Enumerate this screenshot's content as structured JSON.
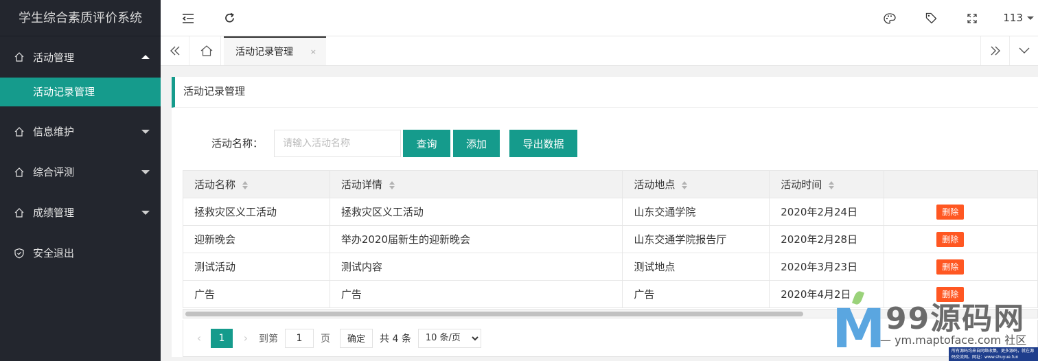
{
  "app": {
    "title": "学生综合素质评价系统"
  },
  "sidebar": {
    "items": [
      {
        "label": "活动管理",
        "icon": "home-icon",
        "expanded": true
      },
      {
        "label": "活动记录管理",
        "active": true
      },
      {
        "label": "信息维护",
        "icon": "home-icon"
      },
      {
        "label": "综合评测",
        "icon": "home-icon"
      },
      {
        "label": "成绩管理",
        "icon": "home-icon"
      },
      {
        "label": "安全退出",
        "icon": "shield-icon"
      }
    ]
  },
  "header": {
    "left_icons": [
      "menu-fold-icon",
      "refresh-icon"
    ],
    "right_icons": [
      "palette-icon",
      "tag-icon",
      "fullscreen-icon"
    ],
    "user": "113"
  },
  "tabs": {
    "active_label": "活动记录管理",
    "close_symbol": "×"
  },
  "panel": {
    "title": "活动记录管理",
    "search": {
      "label": "活动名称：",
      "placeholder": "请输入活动名称",
      "query_label": "查询",
      "add_label": "添加",
      "export_label": "导出数据"
    },
    "table": {
      "columns": [
        "活动名称",
        "活动详情",
        "活动地点",
        "活动时间",
        ""
      ],
      "rows": [
        {
          "name": "拯救灾区义工活动",
          "detail": "拯救灾区义工活动",
          "place": "山东交通学院",
          "time": "2020年2月24日",
          "action": "删除"
        },
        {
          "name": "迎新晚会",
          "detail": "举办2020届新生的迎新晚会",
          "place": "山东交通学院报告厅",
          "time": "2020年2月28日",
          "action": "删除"
        },
        {
          "name": "测试活动",
          "detail": "测试内容",
          "place": "测试地点",
          "time": "2020年3月23日",
          "action": "删除"
        },
        {
          "name": "广告",
          "detail": "广告",
          "place": "广告",
          "time": "2020年4月2日",
          "action": "删除"
        }
      ]
    },
    "pager": {
      "prev": "‹",
      "current": "1",
      "next": "›",
      "goto_label": "到第",
      "goto_value": "1",
      "page_unit": "页",
      "confirm_label": "确定",
      "total_text": "共 4 条",
      "page_size": "10 条/页"
    }
  },
  "watermark": {
    "logo_letter": "M",
    "brand": "99源码网",
    "url": "— ym.maptoface.com 社区",
    "strip": "所有源码均来自网络收集，更多源码，就在源码交流网。网址：www.shuyue.fun"
  },
  "colors": {
    "accent": "#159b8c",
    "sidebar_bg": "#23262e",
    "danger": "#ff5722"
  }
}
